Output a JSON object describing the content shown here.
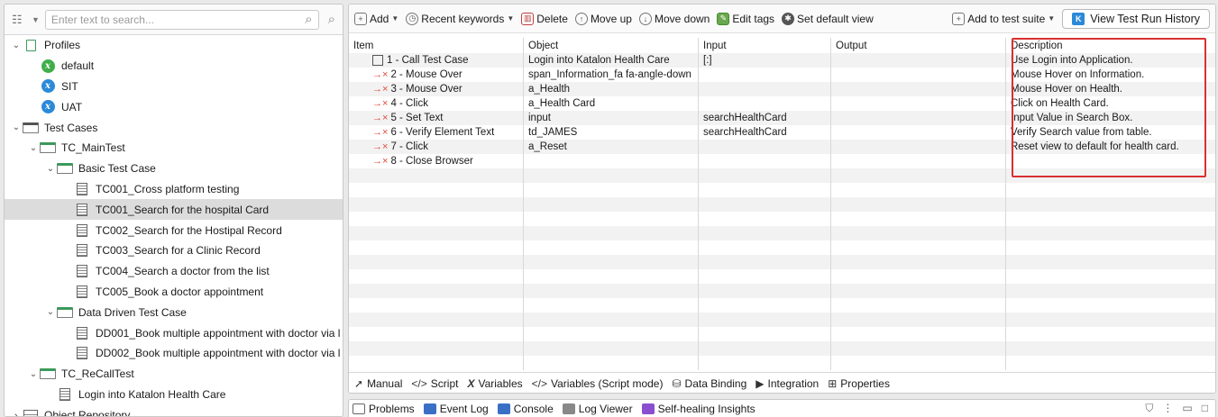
{
  "explorer": {
    "search_placeholder": "Enter text to search...",
    "tree": [
      {
        "label": "Profiles",
        "indent": 0,
        "arrow": "expanded",
        "icon": "profiles"
      },
      {
        "label": "default",
        "indent": 1,
        "arrow": "none",
        "icon": "env-green"
      },
      {
        "label": "SIT",
        "indent": 1,
        "arrow": "none",
        "icon": "env-blue"
      },
      {
        "label": "UAT",
        "indent": 1,
        "arrow": "none",
        "icon": "env-blue"
      },
      {
        "label": "Test Cases",
        "indent": 0,
        "arrow": "expanded",
        "icon": "testcases"
      },
      {
        "label": "TC_MainTest",
        "indent": 1,
        "arrow": "expanded",
        "icon": "folder"
      },
      {
        "label": "Basic Test Case",
        "indent": 2,
        "arrow": "expanded",
        "icon": "folder"
      },
      {
        "label": "TC001_Cross platform testing",
        "indent": 3,
        "arrow": "none",
        "icon": "testcase"
      },
      {
        "label": "TC001_Search for the hospital Card",
        "indent": 3,
        "arrow": "none",
        "icon": "testcase",
        "selected": true
      },
      {
        "label": "TC002_Search for the Hostipal Record",
        "indent": 3,
        "arrow": "none",
        "icon": "testcase"
      },
      {
        "label": "TC003_Search for a Clinic Record",
        "indent": 3,
        "arrow": "none",
        "icon": "testcase"
      },
      {
        "label": "TC004_Search a doctor from the list",
        "indent": 3,
        "arrow": "none",
        "icon": "testcase"
      },
      {
        "label": "TC005_Book a doctor appointment",
        "indent": 3,
        "arrow": "none",
        "icon": "testcase"
      },
      {
        "label": "Data Driven Test Case",
        "indent": 2,
        "arrow": "expanded",
        "icon": "folder"
      },
      {
        "label": "DD001_Book multiple appointment with doctor via l",
        "indent": 3,
        "arrow": "none",
        "icon": "testcase"
      },
      {
        "label": "DD002_Book multiple appointment with doctor via l",
        "indent": 3,
        "arrow": "none",
        "icon": "testcase"
      },
      {
        "label": "TC_ReCallTest",
        "indent": 1,
        "arrow": "expanded",
        "icon": "folder"
      },
      {
        "label": "Login into Katalon Health Care",
        "indent": 2,
        "arrow": "none",
        "icon": "testcase"
      },
      {
        "label": "Object Repository",
        "indent": 0,
        "arrow": "collapsed",
        "icon": "object-repo"
      }
    ]
  },
  "toolbar": {
    "add": "Add",
    "recent_keywords": "Recent keywords",
    "delete": "Delete",
    "move_up": "Move up",
    "move_down": "Move down",
    "edit_tags": "Edit tags",
    "set_default_view": "Set default view",
    "add_to_test_suite": "Add to test suite",
    "view_history": "View Test Run History"
  },
  "table": {
    "headers": [
      "Item",
      "Object",
      "Input",
      "Output",
      "Description"
    ],
    "rows": [
      {
        "item": "1 - Call Test Case",
        "object": "Login into Katalon Health Care",
        "input": "[:]",
        "output": "",
        "description": "Use Login into Application.",
        "kind": "call"
      },
      {
        "item": "2 - Mouse Over",
        "object": "span_Information_fa fa-angle-down",
        "input": "",
        "output": "",
        "description": "Mouse Hover on Information.",
        "kind": "step"
      },
      {
        "item": "3 - Mouse Over",
        "object": "a_Health",
        "input": "",
        "output": "",
        "description": "Mouse Hover on Health.",
        "kind": "step"
      },
      {
        "item": "4 - Click",
        "object": "a_Health Card",
        "input": "",
        "output": "",
        "description": "Click on Health Card.",
        "kind": "step"
      },
      {
        "item": "5 - Set Text",
        "object": "input",
        "input": "searchHealthCard",
        "output": "",
        "description": "Input Value in Search Box.",
        "kind": "step"
      },
      {
        "item": "6 - Verify Element Text",
        "object": "td_JAMES",
        "input": "searchHealthCard",
        "output": "",
        "description": "Verify Search value from table.",
        "kind": "step"
      },
      {
        "item": "7 - Click",
        "object": "a_Reset",
        "input": "",
        "output": "",
        "description": "Reset view to default for health card.",
        "kind": "step"
      },
      {
        "item": "8 - Close Browser",
        "object": "",
        "input": "",
        "output": "",
        "description": "",
        "kind": "step"
      }
    ],
    "empty_rows": 14
  },
  "editor_tabs": [
    "Manual",
    "Script",
    "Variables",
    "Variables (Script mode)",
    "Data Binding",
    "Integration",
    "Properties"
  ],
  "bottom_tabs": [
    "Problems",
    "Event Log",
    "Console",
    "Log Viewer",
    "Self-healing Insights"
  ]
}
